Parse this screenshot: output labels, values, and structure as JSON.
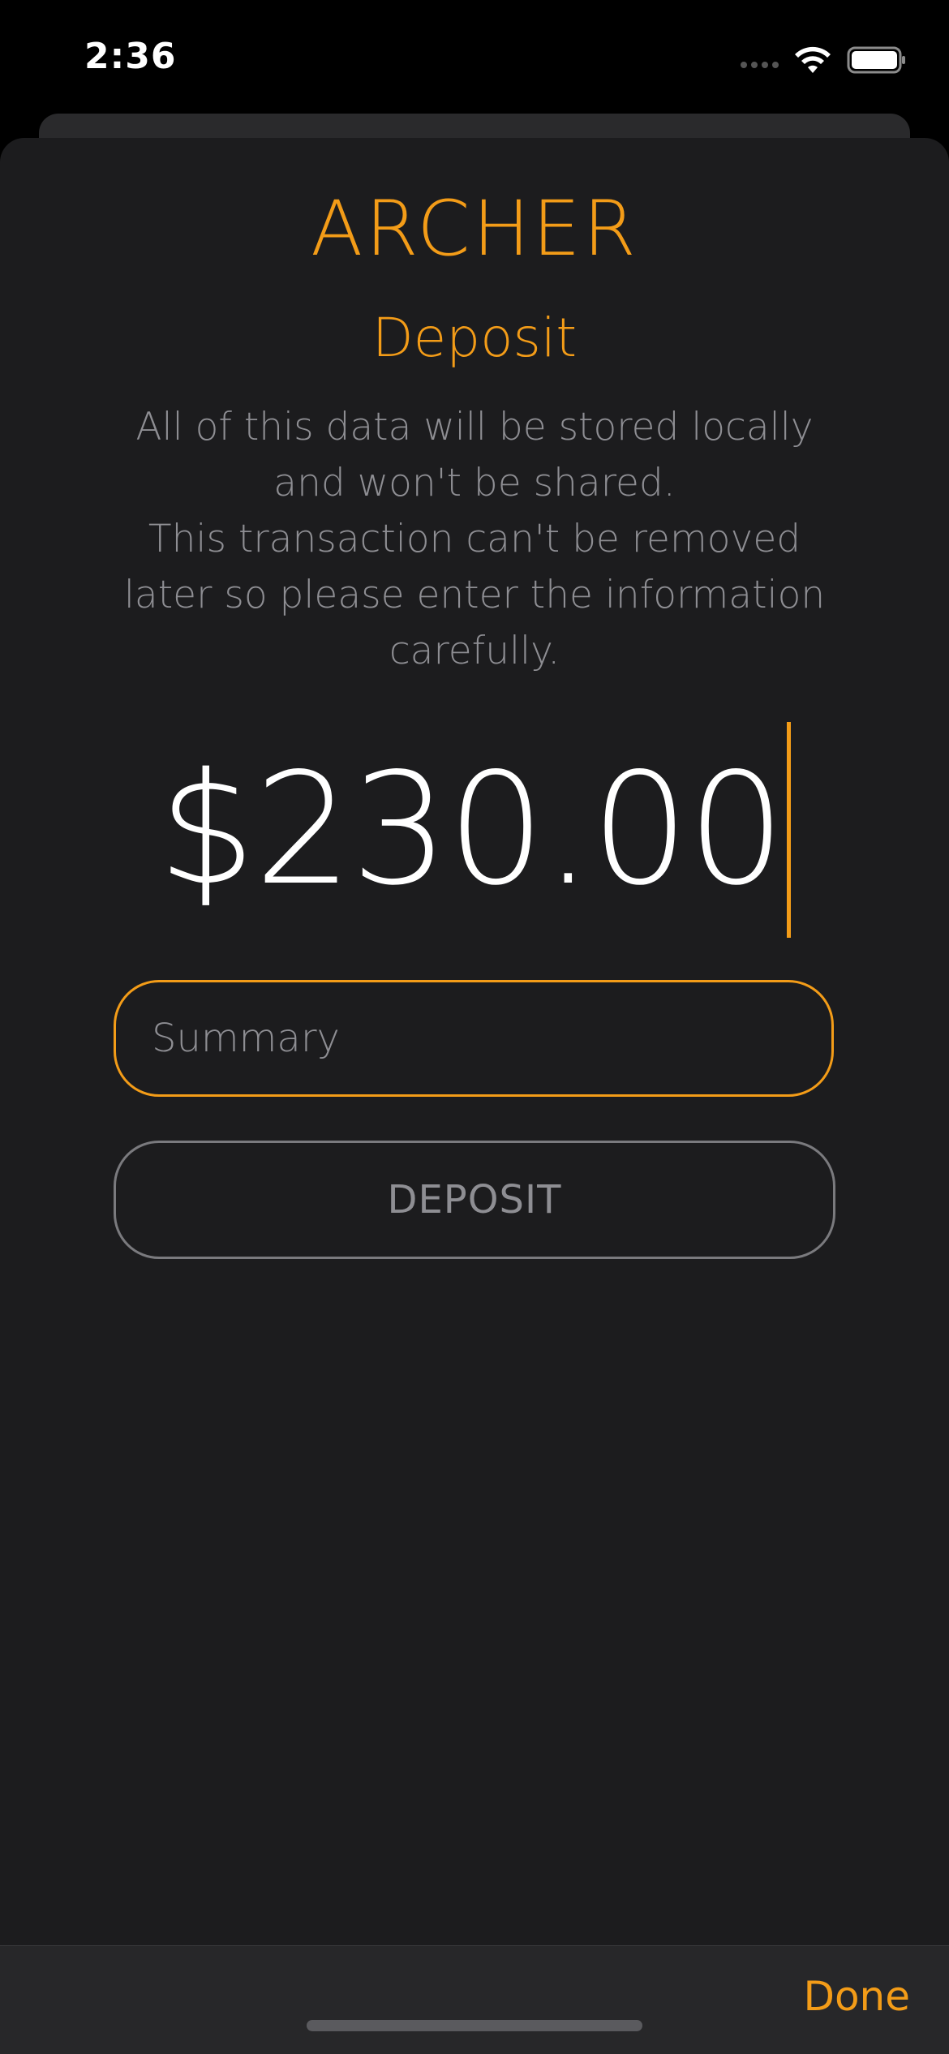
{
  "status_bar": {
    "time": "2:36"
  },
  "app": {
    "title": "ARCHER"
  },
  "page": {
    "title": "Deposit",
    "info_lines": [
      "All of this data will be stored locally and won't be shared.",
      "This transaction can't be removed later so please enter the information carefully."
    ]
  },
  "amount": {
    "value": "$230.00"
  },
  "summary": {
    "placeholder": "Summary",
    "value": ""
  },
  "deposit_button": {
    "label": "DEPOSIT"
  },
  "toolbar": {
    "done_label": "Done"
  },
  "colors": {
    "accent": "#f39c18",
    "background": "#1c1c1e",
    "secondary_text": "#8e8e93",
    "primary_text": "#ffffff"
  },
  "icons": [
    "wifi-icon",
    "battery-icon",
    "signal-icon"
  ]
}
